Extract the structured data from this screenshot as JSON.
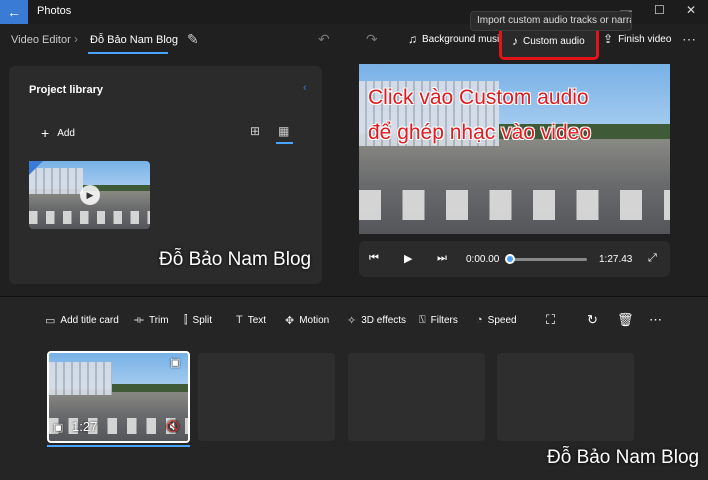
{
  "window": {
    "app_title": "Photos",
    "back_icon": "arrow-left-icon",
    "controls": [
      "minimize-icon",
      "maximize-icon",
      "close-icon"
    ]
  },
  "tooltip": "Import custom audio tracks or narration",
  "breadcrumb": {
    "root": "Video Editor",
    "current": "Đỗ Bảo Nam Blog"
  },
  "toolbar": {
    "background_music": "Background music",
    "custom_audio": "Custom audio",
    "finish_video": "Finish video"
  },
  "library": {
    "title": "Project library",
    "add_label": "Add"
  },
  "watermark": "Đỗ Bảo Nam Blog",
  "annotation": {
    "line1": "Click vào Custom audio",
    "line2": "để ghép nhạc vào video"
  },
  "playback": {
    "current_time": "0:00.00",
    "total_time": "1:27.43",
    "progress": 0.0
  },
  "edit_tools": {
    "add_title_card": "Add title card",
    "trim": "Trim",
    "split": "Split",
    "text": "Text",
    "motion": "Motion",
    "effects_3d": "3D effects",
    "filters": "Filters",
    "speed": "Speed"
  },
  "storyboard": {
    "clip_duration": "1:27",
    "empty_slots": 3
  },
  "colors": {
    "accent": "#4aa3ff",
    "highlight_box": "#e0141a",
    "annotation_text": "#e11a1f"
  }
}
